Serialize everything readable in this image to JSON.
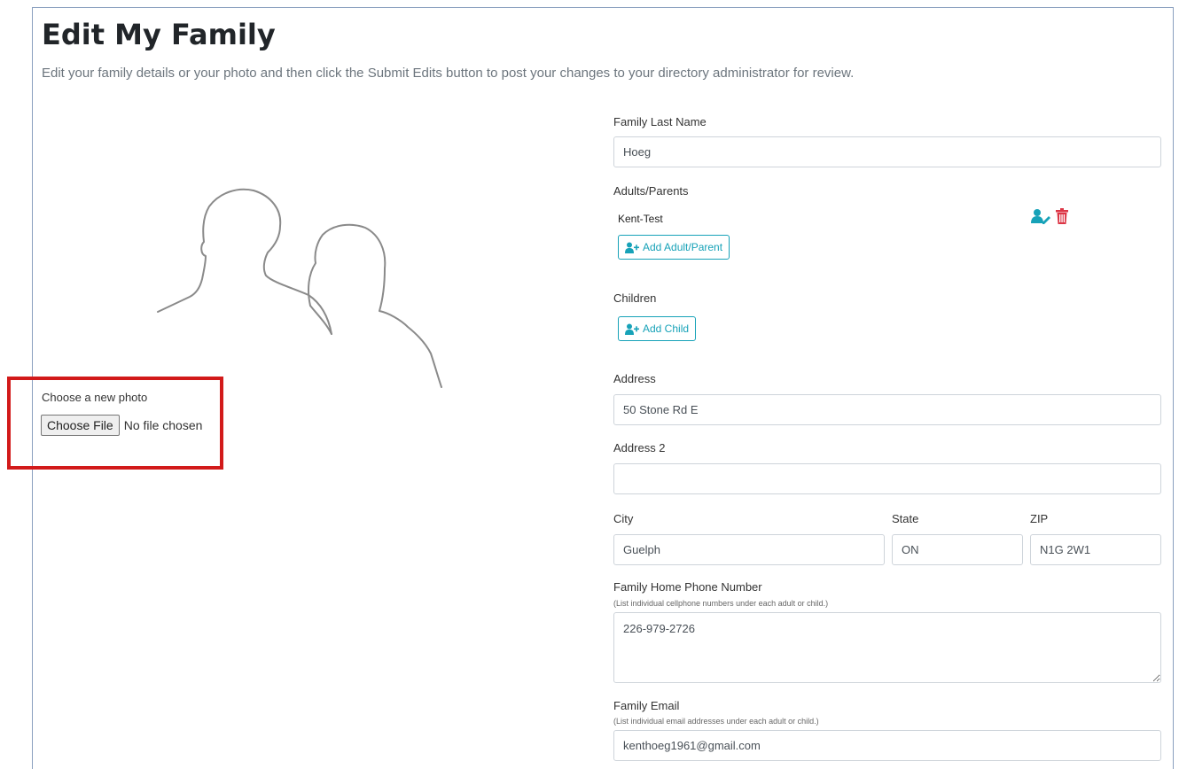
{
  "page": {
    "title": "Edit My Family",
    "description": "Edit your family details or your photo and then click the Submit Edits button to post your changes to your directory administrator for review."
  },
  "photo": {
    "choose_label": "Choose a new photo",
    "file_button": "Choose File",
    "file_status": "No file chosen"
  },
  "form": {
    "last_name": {
      "label": "Family Last Name",
      "value": "Hoeg"
    },
    "adults": {
      "label": "Adults/Parents",
      "items": [
        {
          "name": "Kent-Test"
        }
      ],
      "add_button": "Add Adult/Parent"
    },
    "children": {
      "label": "Children",
      "add_button": "Add Child"
    },
    "address": {
      "label": "Address",
      "value": "50 Stone Rd E"
    },
    "address2": {
      "label": "Address 2",
      "value": ""
    },
    "city": {
      "label": "City",
      "value": "Guelph"
    },
    "state": {
      "label": "State",
      "value": "ON"
    },
    "zip": {
      "label": "ZIP",
      "value": "N1G 2W1"
    },
    "phone": {
      "label": "Family Home Phone Number",
      "hint": "(List individual cellphone numbers under each adult or child.)",
      "value": "226-979-2726"
    },
    "email": {
      "label": "Family Email",
      "hint": "(List individual email addresses under each adult or child.)",
      "value": "kenthoeg1961@gmail.com"
    }
  },
  "colors": {
    "accent": "#17a2b8",
    "danger": "#dc3545",
    "highlight": "#d21a1a"
  },
  "icons": {
    "edit_person": "user-edit-icon",
    "delete_person": "trash-icon",
    "add_person": "user-plus-icon"
  }
}
